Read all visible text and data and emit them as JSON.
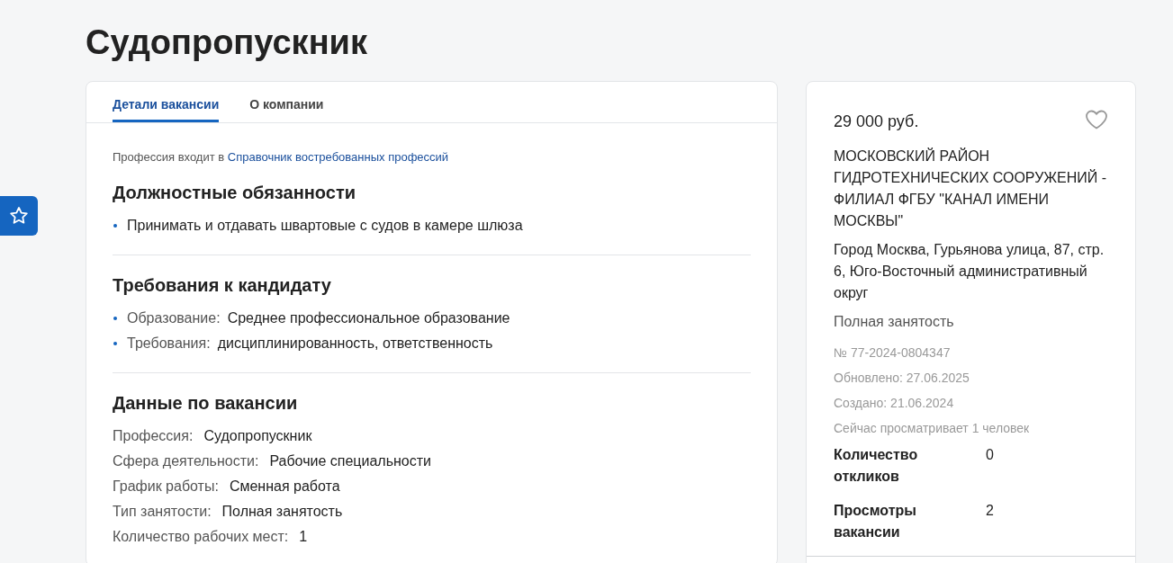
{
  "page_title": "Судопропускник",
  "tabs": [
    {
      "label": "Детали вакансии",
      "selected": true
    },
    {
      "label": "О компании",
      "selected": false
    }
  ],
  "reference": {
    "text": "Профессия входит в",
    "link": "Справочник востребованных профессий"
  },
  "sections": [
    {
      "title": "Должностные обязанности",
      "kind": "bullets",
      "items": [
        {
          "value": "Принимать и отдавать швартовые с судов в камере шлюза"
        }
      ]
    },
    {
      "title": "Требования к кандидату",
      "kind": "bullets",
      "items": [
        {
          "label": "Образование:",
          "value": "Среднее профессиональное образование"
        },
        {
          "label": "Требования:",
          "value": "дисциплинированность, ответственность"
        }
      ]
    },
    {
      "title": "Данные по вакансии",
      "kind": "pairs",
      "items": [
        {
          "label": "Профессия:",
          "value": "Судопропускник"
        },
        {
          "label": "Сфера деятельности:",
          "value": "Рабочие специальности"
        },
        {
          "label": "График работы:",
          "value": "Сменная работа"
        },
        {
          "label": "Тип занятости:",
          "value": "Полная занятость"
        },
        {
          "label": "Количество рабочих мест:",
          "value": "1"
        }
      ]
    }
  ],
  "summary": {
    "salary": "29 000 руб.",
    "favorite": false,
    "employer": "МОСКОВСКИЙ РАЙОН ГИДРОТЕХНИЧЕСКИХ СООРУЖЕНИЙ - ФИЛИАЛ ФГБУ \"КАНАЛ ИМЕНИ МОСКВЫ\"",
    "address": "Город Москва, Гурьянова улица, 87, стр. 6, Юго-Восточный административный округ",
    "employment": "Полная занятость",
    "meta": [
      "№ 77-2024-0804347",
      "Обновлено: 27.06.2025",
      "Создано: 21.06.2024",
      "Сейчас просматривает 1 человек"
    ],
    "stats": [
      {
        "label": "Количество откликов",
        "value": "0"
      },
      {
        "label": "Просмотры вакансии",
        "value": "2"
      }
    ]
  }
}
